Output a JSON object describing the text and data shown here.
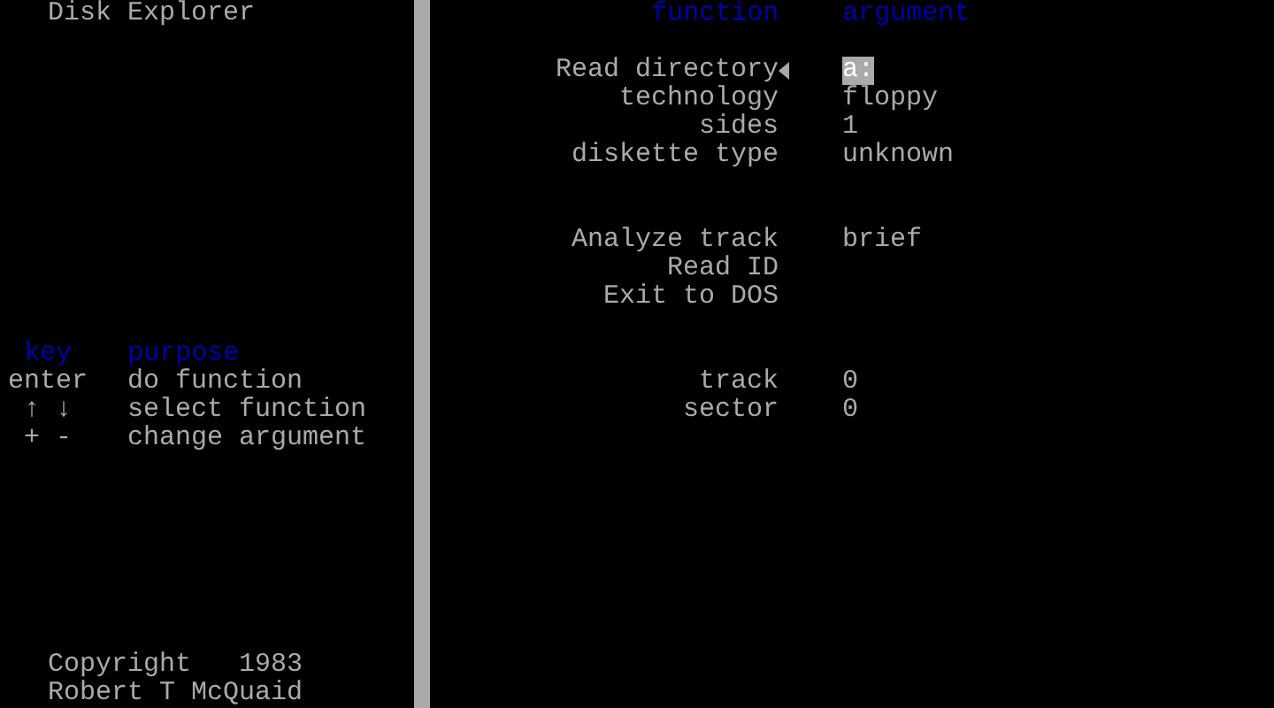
{
  "title": "Disk Explorer",
  "keys": {
    "headers": [
      "key",
      "purpose"
    ],
    "rows": [
      {
        "key": "enter",
        "purpose": "do function"
      },
      {
        "key": "↑ ↓",
        "purpose": "select function"
      },
      {
        "key": "+ -",
        "purpose": "change argument"
      }
    ]
  },
  "copyright": {
    "label": "Copyright",
    "year": "1983",
    "author": "Robert T McQuaid"
  },
  "menu": {
    "headers": [
      "function",
      "argument"
    ],
    "groups": [
      [
        {
          "label": "Read directory",
          "argument": "a:",
          "selected": true
        },
        {
          "label": "technology",
          "argument": "floppy",
          "selected": false
        },
        {
          "label": "sides",
          "argument": "1",
          "selected": false
        },
        {
          "label": "diskette type",
          "argument": "unknown",
          "selected": false
        }
      ],
      [
        {
          "label": "Analyze track",
          "argument": "brief",
          "selected": false
        },
        {
          "label": "Read ID",
          "selected": false
        },
        {
          "label": "Exit to DOS",
          "selected": false
        }
      ],
      [
        {
          "label": "track",
          "argument": "0",
          "selected": false
        },
        {
          "label": "sector",
          "argument": "0",
          "selected": false
        }
      ]
    ]
  }
}
